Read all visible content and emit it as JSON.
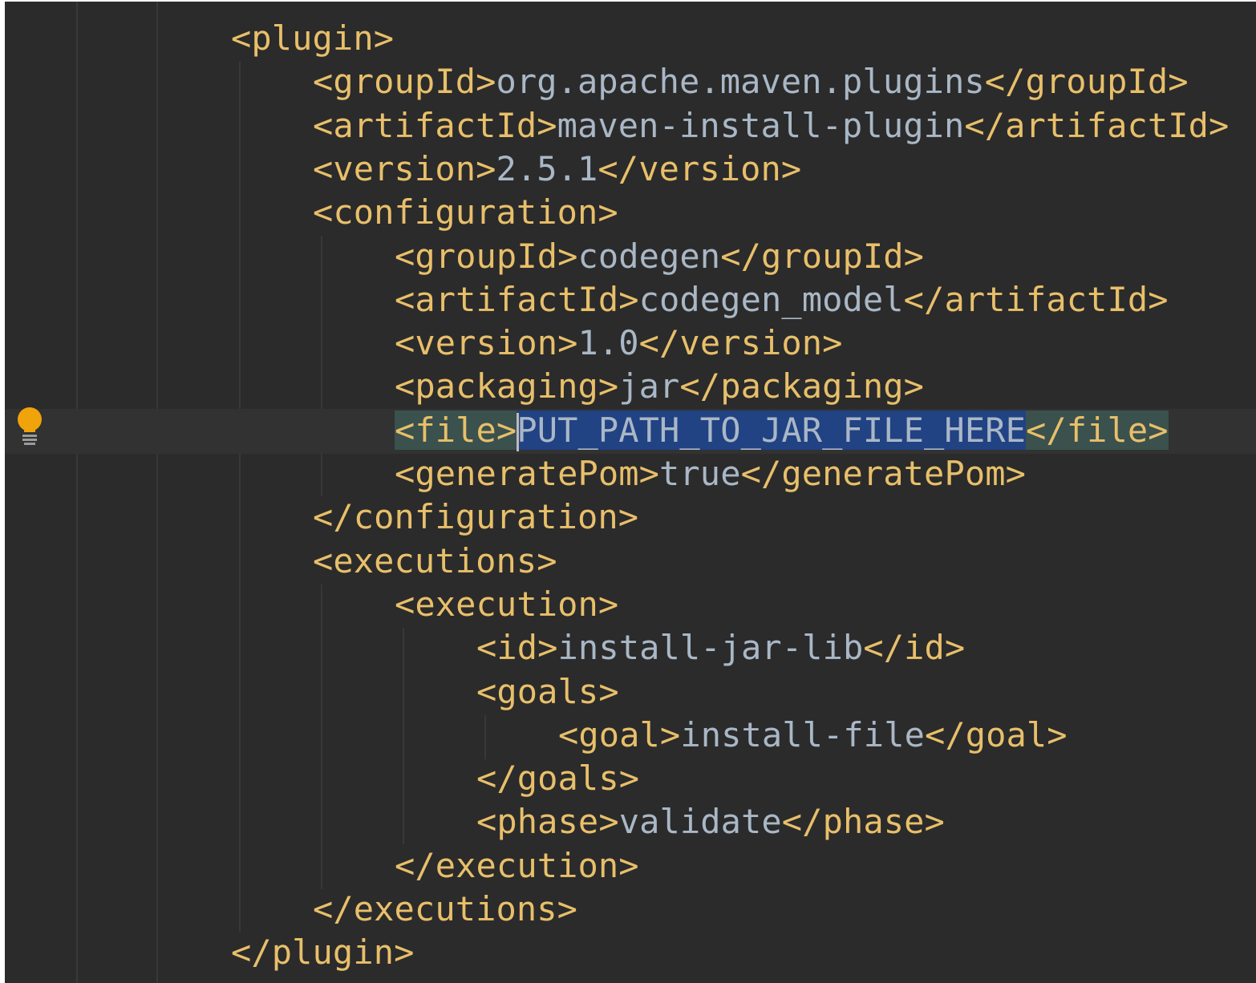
{
  "editor": {
    "gutter_icon": "lightbulb-icon",
    "colors": {
      "background": "#2b2b2b",
      "tag": "#e8bf6a",
      "text": "#a9b7c6",
      "selection": "#214283",
      "tag_match": "#3b514d",
      "bulb": "#f0a30a"
    },
    "lines": [
      {
        "indent": 0,
        "open": "<plugin>",
        "value": "",
        "close": ""
      },
      {
        "indent": 1,
        "open": "<groupId>",
        "value": "org.apache.maven.plugins",
        "close": "</groupId>"
      },
      {
        "indent": 1,
        "open": "<artifactId>",
        "value": "maven-install-plugin",
        "close": "</artifactId>"
      },
      {
        "indent": 1,
        "open": "<version>",
        "value": "2.5.1",
        "close": "</version>"
      },
      {
        "indent": 1,
        "open": "<configuration>",
        "value": "",
        "close": ""
      },
      {
        "indent": 2,
        "open": "<groupId>",
        "value": "codegen",
        "close": "</groupId>"
      },
      {
        "indent": 2,
        "open": "<artifactId>",
        "value": "codegen_model",
        "close": "</artifactId>"
      },
      {
        "indent": 2,
        "open": "<version>",
        "value": "1.0",
        "close": "</version>"
      },
      {
        "indent": 2,
        "open": "<packaging>",
        "value": "jar",
        "close": "</packaging>"
      },
      {
        "indent": 2,
        "open": "<file>",
        "value": "PUT_PATH_TO_JAR_FILE_HERE",
        "close": "</file>",
        "selected": true
      },
      {
        "indent": 2,
        "open": "<generatePom>",
        "value": "true",
        "close": "</generatePom>"
      },
      {
        "indent": 1,
        "open": "</configuration>",
        "value": "",
        "close": ""
      },
      {
        "indent": 1,
        "open": "<executions>",
        "value": "",
        "close": ""
      },
      {
        "indent": 2,
        "open": "<execution>",
        "value": "",
        "close": ""
      },
      {
        "indent": 3,
        "open": "<id>",
        "value": "install-jar-lib",
        "close": "</id>"
      },
      {
        "indent": 3,
        "open": "<goals>",
        "value": "",
        "close": ""
      },
      {
        "indent": 4,
        "open": "<goal>",
        "value": "install-file",
        "close": "</goal>"
      },
      {
        "indent": 3,
        "open": "</goals>",
        "value": "",
        "close": ""
      },
      {
        "indent": 3,
        "open": "<phase>",
        "value": "validate",
        "close": "</phase>"
      },
      {
        "indent": 2,
        "open": "</execution>",
        "value": "",
        "close": ""
      },
      {
        "indent": 1,
        "open": "</executions>",
        "value": "",
        "close": ""
      },
      {
        "indent": 0,
        "open": "</plugin>",
        "value": "",
        "close": ""
      }
    ]
  }
}
